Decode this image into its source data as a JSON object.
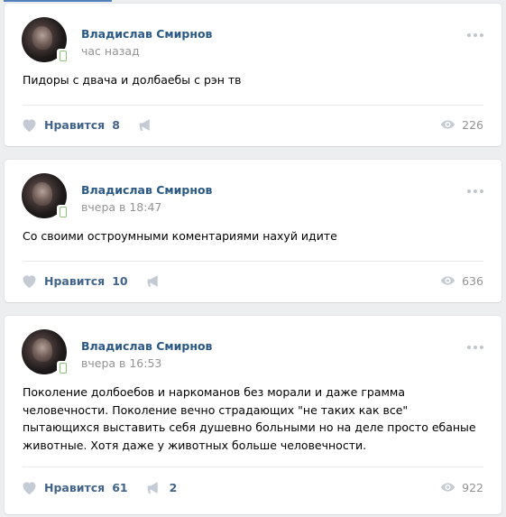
{
  "posts": [
    {
      "author": "Владислав Смирнов",
      "time": "час назад",
      "text": "Пидоры с двача и долбаебы с рэн тв",
      "like_label": "Нравится",
      "likes": "8",
      "shares": "",
      "views": "226"
    },
    {
      "author": "Владислав Смирнов",
      "time": "вчера в 18:47",
      "text": "Со своими остроумными коментариями нахуй идите",
      "like_label": "Нравится",
      "likes": "10",
      "shares": "",
      "views": "636"
    },
    {
      "author": "Владислав Смирнов",
      "time": "вчера в 16:53",
      "text": "Поколение долбоебов и наркоманов без морали и даже грамма человечности. Поколение вечно страдающих \"не таких как все\" пытающихся выставить себя душевно больными но на деле просто ебаные животные. Хотя даже у животных больше человечности.",
      "like_label": "Нравится",
      "likes": "61",
      "shares": "2",
      "views": "922"
    }
  ],
  "colors": {
    "background": "#edeef0",
    "link": "#2a5885",
    "action": "#42648b",
    "muted": "#939393",
    "icon": "#c4cbd5"
  },
  "icons": {
    "like": "heart-icon",
    "share": "megaphone-icon",
    "views": "eye-icon",
    "more": "more-dots-icon",
    "online": "mobile-online-icon"
  }
}
